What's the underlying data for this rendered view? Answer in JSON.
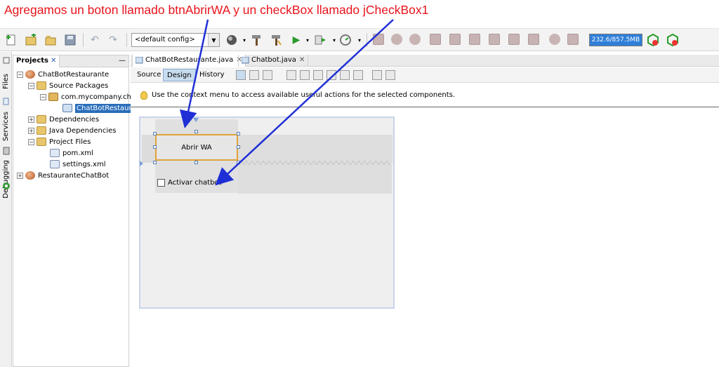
{
  "annotation": "Agregamos un boton llamado btnAbrirWA y un checkBox llamado jCheckBox1",
  "toolbar": {
    "config_value": "<default config>",
    "memory": "232.6/857.5MB"
  },
  "side_strip": {
    "files": "Files",
    "services": "Services",
    "debugging": "Debugging"
  },
  "projects_panel": {
    "tab_label": "Projects",
    "close": "✕",
    "minimize": "—",
    "tree": {
      "project1": "ChatBotRestaurante",
      "source_packages": "Source Packages",
      "package": "com.mycompany.cha",
      "form_file": "ChatBotRestaura",
      "dependencies": "Dependencies",
      "java_dependencies": "Java Dependencies",
      "project_files": "Project Files",
      "pom": "pom.xml",
      "settings": "settings.xml",
      "project2": "RestauranteChatBot"
    }
  },
  "editor": {
    "tab1": "ChatBotRestaurante.java",
    "tab2": "Chatbot.java",
    "modes": {
      "source": "Source",
      "design": "Design",
      "history": "History"
    },
    "hint": "Use the context menu to access available useful actions for the selected components."
  },
  "form": {
    "button_label": "Abrir WA",
    "checkbox_label": "Activar chatbot",
    "checkbox_checked": false
  },
  "colors": {
    "annotation": "#e8141c",
    "arrow": "#1f2fd6",
    "selection": "#e0a23a",
    "memory_bar": "#2f7ed8"
  }
}
